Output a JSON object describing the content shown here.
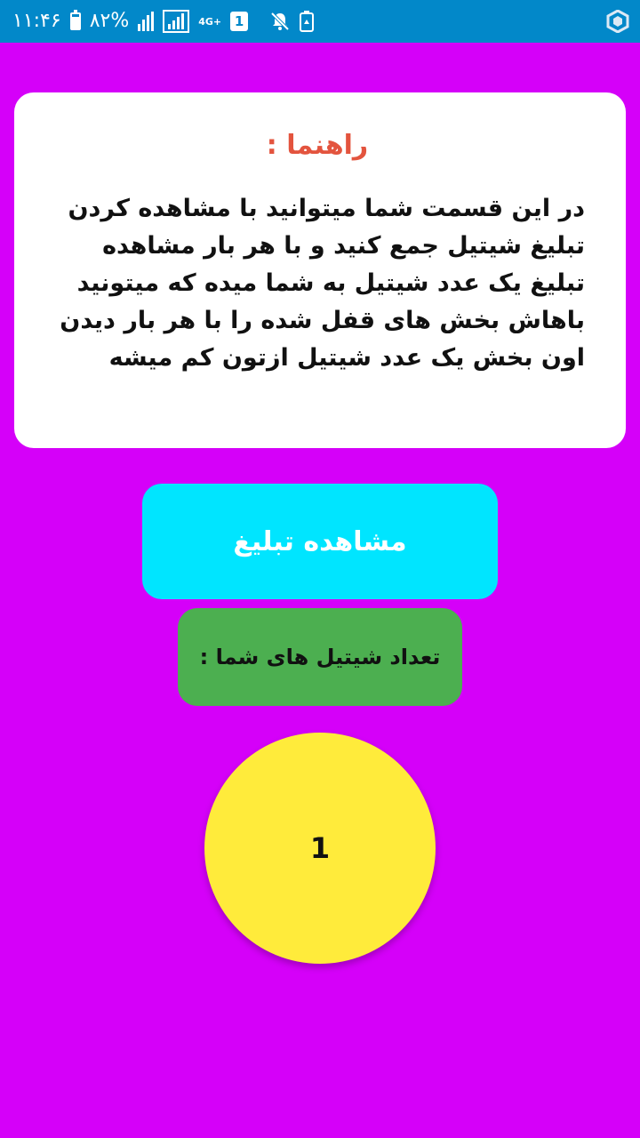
{
  "status_bar": {
    "time": "۱۱:۴۶",
    "battery_percent": "۸۲%",
    "battery_level": 0.82,
    "network_type": "4G+",
    "sim_number": "1",
    "icons": [
      "battery-icon",
      "signal-icon",
      "signal-box-icon",
      "network-4g-icon",
      "sim-icon",
      "mute-icon",
      "recycle-battery-icon",
      "app-hex-icon"
    ],
    "background_color": "#0288c9"
  },
  "guide": {
    "title": "راهنما :",
    "body": "در این قسمت شما میتوانید با مشاهده کردن تبلیغ شیتیل جمع کنید و با هر بار مشاهده تبلیغ یک عدد شیتیل به شما میده که میتونید باهاش بخش های قفل شده را با هر بار دیدن اون بخش یک عدد شیتیل ازتون کم میشه",
    "title_color": "#e3543e"
  },
  "watch_ad_button": {
    "label": "مشاهده تبلیغ",
    "color": "#00e5ff"
  },
  "count": {
    "label": "تعداد شیتیل های شما :",
    "value": "1",
    "label_bg_color": "#4caf50",
    "circle_color": "#ffeb3b"
  },
  "page": {
    "background_color": "#d500f9"
  }
}
